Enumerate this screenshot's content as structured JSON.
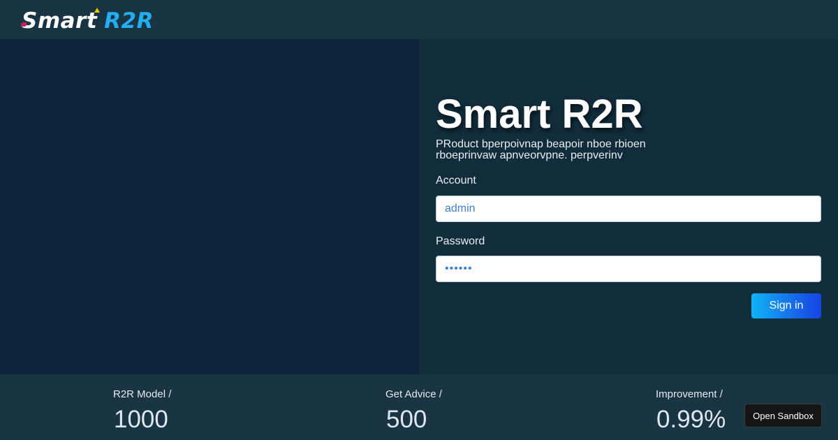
{
  "header": {
    "logo_word1": "Smart",
    "logo_word2": "R2R"
  },
  "login": {
    "title": "Smart R2R",
    "description": "PRoduct bperpoivnap beapoir nboe rbioen rboeprinvaw apnveorvpne. perpverinv",
    "account_label": "Account",
    "account_value": "admin",
    "password_label": "Password",
    "password_value": "••••••",
    "signin_label": "Sign in"
  },
  "stats": [
    {
      "label": "R2R Model /",
      "value": "1000"
    },
    {
      "label": "Get Advice /",
      "value": "500"
    },
    {
      "label": "Improvement /",
      "value": "0.99%"
    }
  ],
  "sandbox_button": "Open Sandbox",
  "colors": {
    "accent": "#22aef0",
    "button_gradient_start": "#10b4f7",
    "button_gradient_end": "#1645e2",
    "left_panel": "#0c253d",
    "right_panel": "#112c3b",
    "background": "#193442"
  }
}
